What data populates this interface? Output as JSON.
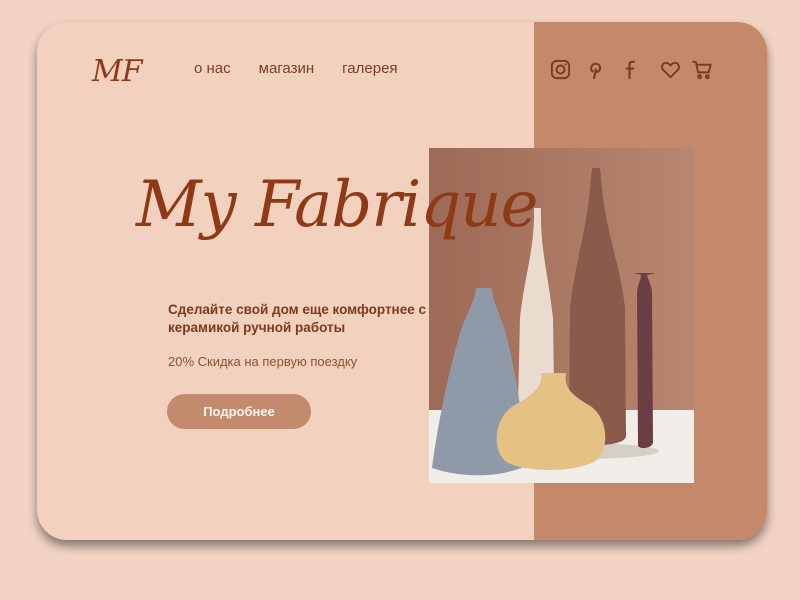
{
  "brand": {
    "logo": "MF"
  },
  "nav": {
    "items": [
      "о нас",
      "магазин",
      "галерея"
    ]
  },
  "icons": {
    "social": [
      "instagram-icon",
      "pinterest-icon",
      "facebook-icon"
    ],
    "actions": [
      "heart-icon",
      "cart-icon"
    ]
  },
  "hero": {
    "title": "My Fabrique",
    "subtitle": "Сделайте свой дом еще комфортнее с керамикой ручной работы",
    "discount": "20% Скидка на первую поездку",
    "cta_label": "Подробнее"
  },
  "colors": {
    "background": "#f3d4c4",
    "card": "#f3d1bf",
    "panel": "#c4886b",
    "accent": "#8f3a17",
    "button": "#c48a6e"
  }
}
